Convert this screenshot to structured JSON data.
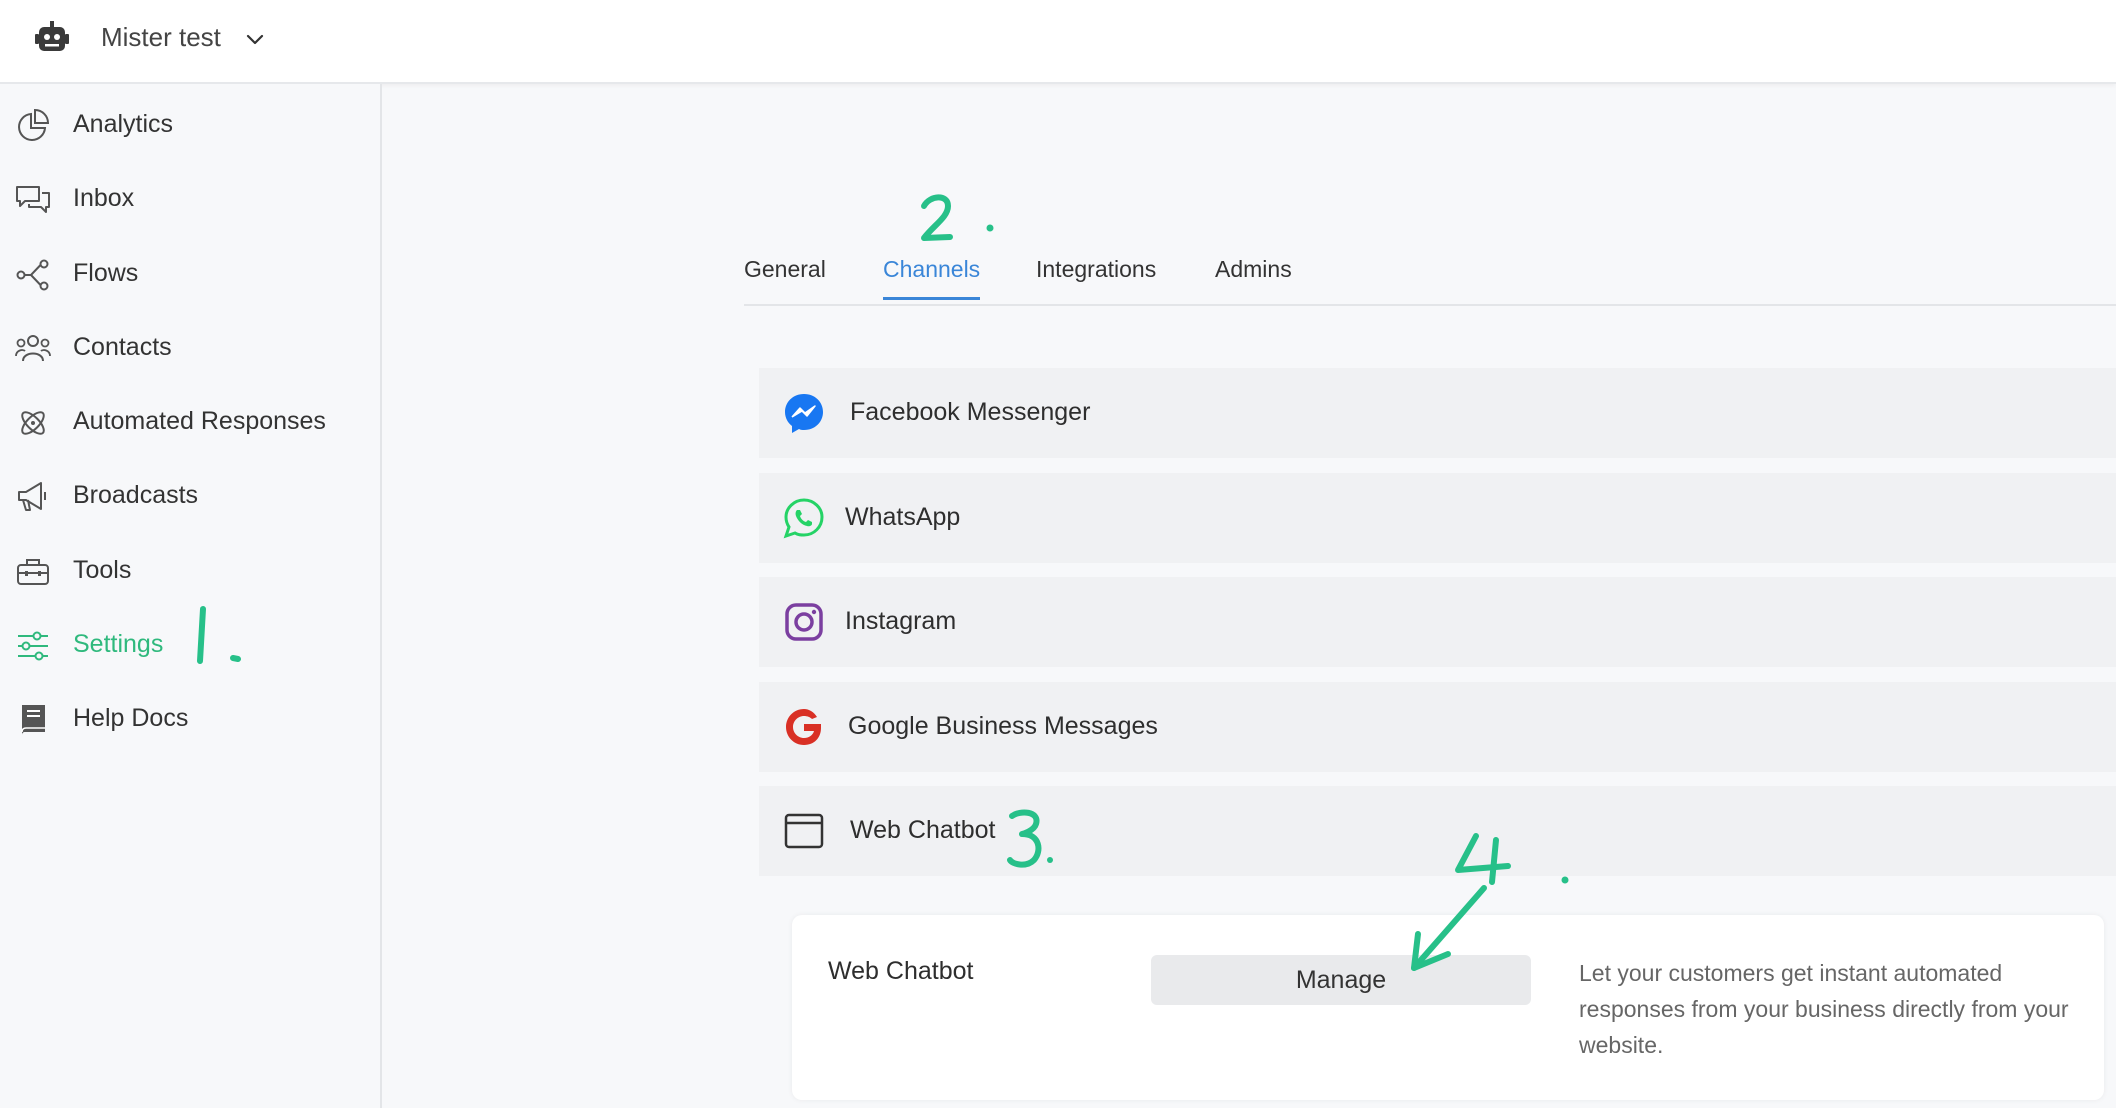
{
  "header": {
    "workspace_name": "Mister test",
    "workspace_icon": "robot-icon",
    "dropdown_icon": "chevron-down-icon"
  },
  "sidebar": {
    "items": [
      {
        "label": "Analytics",
        "icon": "pie-chart-icon",
        "active": false
      },
      {
        "label": "Inbox",
        "icon": "chat-bubbles-icon",
        "active": false
      },
      {
        "label": "Flows",
        "icon": "flow-nodes-icon",
        "active": false
      },
      {
        "label": "Contacts",
        "icon": "people-icon",
        "active": false
      },
      {
        "label": "Automated Responses",
        "icon": "atom-icon",
        "active": false
      },
      {
        "label": "Broadcasts",
        "icon": "megaphone-icon",
        "active": false
      },
      {
        "label": "Tools",
        "icon": "toolbox-icon",
        "active": false
      },
      {
        "label": "Settings",
        "icon": "sliders-icon",
        "active": true
      },
      {
        "label": "Help Docs",
        "icon": "book-icon",
        "active": false
      }
    ]
  },
  "tabs": [
    {
      "label": "General",
      "active": false
    },
    {
      "label": "Channels",
      "active": true
    },
    {
      "label": "Integrations",
      "active": false
    },
    {
      "label": "Admins",
      "active": false
    }
  ],
  "channels": [
    {
      "label": "Facebook Messenger",
      "icon": "messenger-icon"
    },
    {
      "label": "WhatsApp",
      "icon": "whatsapp-icon"
    },
    {
      "label": "Instagram",
      "icon": "instagram-icon"
    },
    {
      "label": "Google Business Messages",
      "icon": "google-icon"
    },
    {
      "label": "Web Chatbot",
      "icon": "browser-window-icon"
    }
  ],
  "web_chatbot_card": {
    "title": "Web Chatbot",
    "button_label": "Manage",
    "description": "Let your customers get instant automated responses from your business directly from your website."
  },
  "annotations": {
    "step1": "1.",
    "step2": "2.",
    "step3": "3.",
    "step4": "4."
  },
  "colors": {
    "accent_green": "#2fb97d",
    "tab_active_blue": "#3a86d8",
    "annotation_green": "#27c089",
    "messenger_blue": "#1877f2",
    "whatsapp_green": "#25d366",
    "instagram_purple": "#7b3fa0",
    "google_red": "#d93025"
  }
}
